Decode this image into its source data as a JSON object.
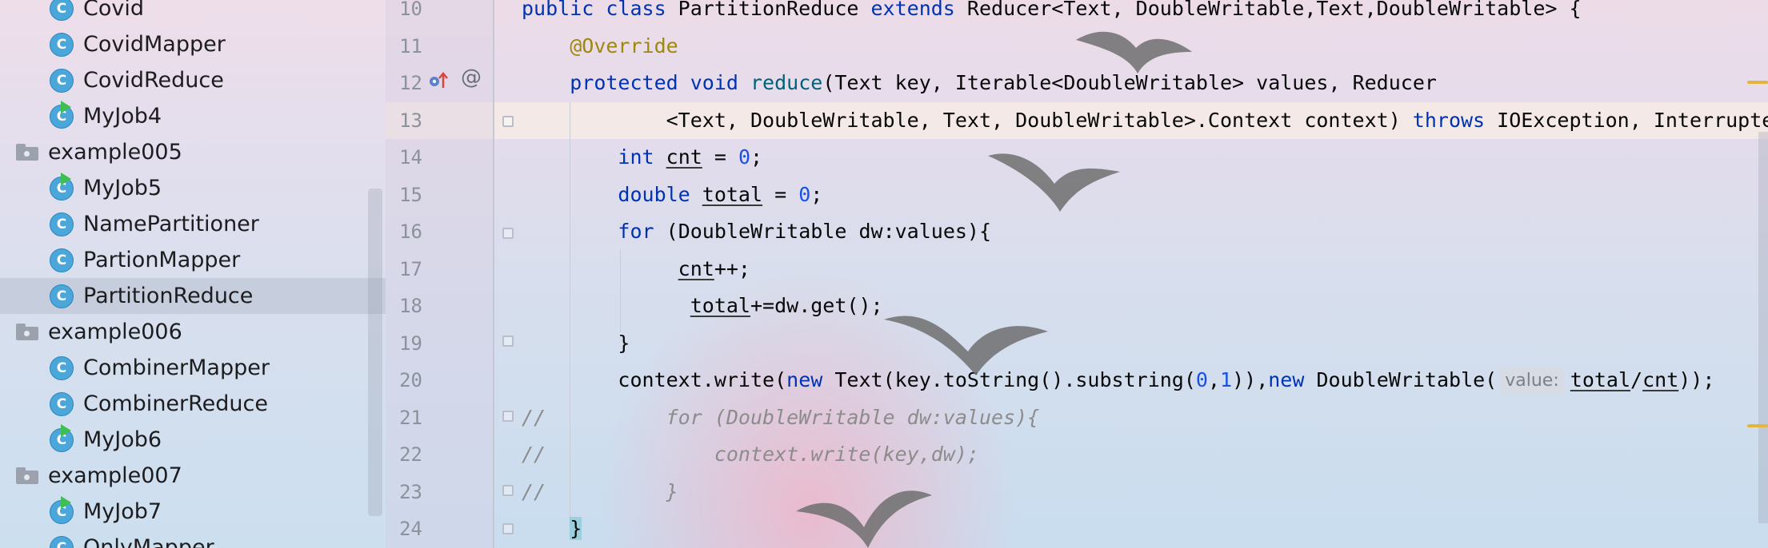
{
  "project_tree": {
    "items": [
      {
        "label": "Covid",
        "kind": "class",
        "runnable": false,
        "selected": false
      },
      {
        "label": "CovidMapper",
        "kind": "class",
        "runnable": false,
        "selected": false
      },
      {
        "label": "CovidReduce",
        "kind": "class",
        "runnable": false,
        "selected": false
      },
      {
        "label": "MyJob4",
        "kind": "class",
        "runnable": true,
        "selected": false
      },
      {
        "label": "example005",
        "kind": "package",
        "runnable": false,
        "selected": false
      },
      {
        "label": "MyJob5",
        "kind": "class",
        "runnable": true,
        "selected": false
      },
      {
        "label": "NamePartitioner",
        "kind": "class",
        "runnable": false,
        "selected": false
      },
      {
        "label": "PartionMapper",
        "kind": "class",
        "runnable": false,
        "selected": false
      },
      {
        "label": "PartitionReduce",
        "kind": "class",
        "runnable": false,
        "selected": true
      },
      {
        "label": "example006",
        "kind": "package",
        "runnable": false,
        "selected": false
      },
      {
        "label": "CombinerMapper",
        "kind": "class",
        "runnable": false,
        "selected": false
      },
      {
        "label": "CombinerReduce",
        "kind": "class",
        "runnable": false,
        "selected": false
      },
      {
        "label": "MyJob6",
        "kind": "class",
        "runnable": true,
        "selected": false
      },
      {
        "label": "example007",
        "kind": "package",
        "runnable": false,
        "selected": false
      },
      {
        "label": "MyJob7",
        "kind": "class",
        "runnable": true,
        "selected": false
      },
      {
        "label": "OnlyMapper",
        "kind": "class",
        "runnable": false,
        "selected": false
      }
    ],
    "class_icon_letter": "C"
  },
  "editor": {
    "current_line": 13,
    "line_numbers": [
      "10",
      "11",
      "12",
      "13",
      "14",
      "15",
      "16",
      "17",
      "18",
      "19",
      "20",
      "21",
      "22",
      "23",
      "24"
    ],
    "gutter_markers": {
      "override_icon": "override-icon",
      "annotation_icon_text": "@"
    },
    "inlay_hint": "value:",
    "colors": {
      "keyword": "#0033b3",
      "number": "#1750eb",
      "annotation": "#9e880d",
      "method": "#00627a",
      "comment": "#8c8c8c"
    },
    "lines": [
      [
        {
          "t": "public class ",
          "k": "kw"
        },
        {
          "t": "PartitionReduce "
        },
        {
          "t": "extends ",
          "k": "kw"
        },
        {
          "t": "Reducer<Text, DoubleWritable,Text,DoubleWritable> {"
        }
      ],
      [
        {
          "t": "    "
        },
        {
          "t": "@Override",
          "k": "ann"
        }
      ],
      [
        {
          "t": "    "
        },
        {
          "t": "protected void ",
          "k": "kw"
        },
        {
          "t": "reduce",
          "k": "fn"
        },
        {
          "t": "(Text key, Iterable<DoubleWritable> values, Reducer"
        }
      ],
      [
        {
          "t": "            <Text, DoubleWritable, Text, DoubleWritable>.Context context) "
        },
        {
          "t": "throws ",
          "k": "kw"
        },
        {
          "t": "IOException, InterruptedException {"
        }
      ],
      [
        {
          "t": "        "
        },
        {
          "t": "int ",
          "k": "kw"
        },
        {
          "t": "cnt",
          "k": "var"
        },
        {
          "t": " = "
        },
        {
          "t": "0",
          "k": "num"
        },
        {
          "t": ";"
        }
      ],
      [
        {
          "t": "        "
        },
        {
          "t": "double ",
          "k": "kw"
        },
        {
          "t": "total",
          "k": "var"
        },
        {
          "t": " = "
        },
        {
          "t": "0",
          "k": "num"
        },
        {
          "t": ";"
        }
      ],
      [
        {
          "t": "        "
        },
        {
          "t": "for ",
          "k": "kw"
        },
        {
          "t": "(DoubleWritable dw:values){"
        }
      ],
      [
        {
          "t": "             "
        },
        {
          "t": "cnt",
          "k": "var"
        },
        {
          "t": "++;"
        }
      ],
      [
        {
          "t": "              "
        },
        {
          "t": "total",
          "k": "var"
        },
        {
          "t": "+=dw.get();"
        }
      ],
      [
        {
          "t": "        }"
        }
      ],
      [
        {
          "t": "        context.write("
        },
        {
          "t": "new ",
          "k": "kw"
        },
        {
          "t": "Text(key.toString().substring("
        },
        {
          "t": "0",
          "k": "num"
        },
        {
          "t": ","
        },
        {
          "t": "1",
          "k": "num"
        },
        {
          "t": ")),"
        },
        {
          "t": "new ",
          "k": "kw"
        },
        {
          "t": "DoubleWritable("
        },
        {
          "t": "value:",
          "k": "hint"
        },
        {
          "t": "total",
          "k": "var"
        },
        {
          "t": "/"
        },
        {
          "t": "cnt",
          "k": "var"
        },
        {
          "t": "));"
        }
      ],
      [
        {
          "t": "//          for (DoubleWritable dw:values){",
          "k": "cm"
        }
      ],
      [
        {
          "t": "//              context.write(key,dw);",
          "k": "cm"
        }
      ],
      [
        {
          "t": "//          }",
          "k": "cm"
        }
      ],
      [
        {
          "t": "    "
        },
        {
          "t": "}",
          "k": "bracket"
        }
      ]
    ]
  }
}
